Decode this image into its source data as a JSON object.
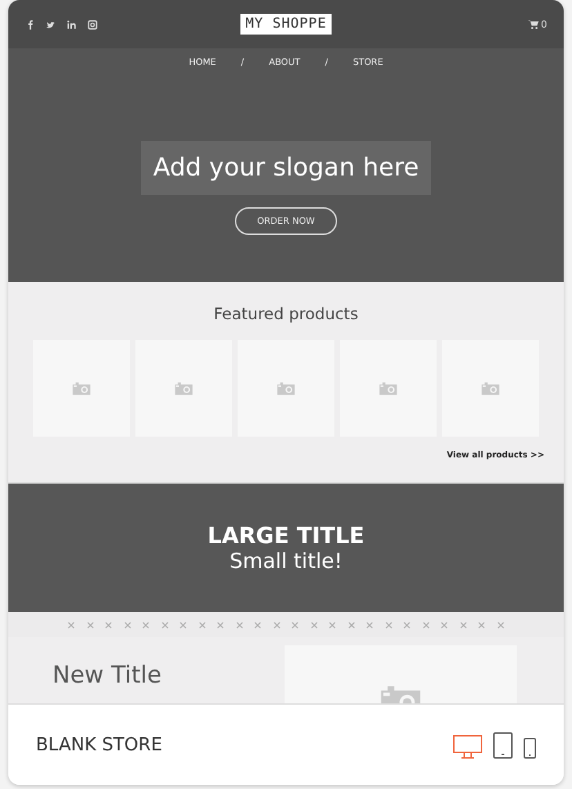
{
  "header": {
    "social": [
      {
        "kind": "facebook"
      },
      {
        "kind": "twitter"
      },
      {
        "kind": "linkedin"
      },
      {
        "kind": "instagram"
      }
    ],
    "logo": "MY SHOPPE",
    "cart_count": "0"
  },
  "nav": {
    "items": [
      "HOME",
      "ABOUT",
      "STORE"
    ],
    "separator": "/"
  },
  "hero": {
    "slogan": "Add your slogan here",
    "button": "ORDER NOW"
  },
  "featured": {
    "title": "Featured products",
    "products": [
      {
        "kind": "placeholder"
      },
      {
        "kind": "placeholder"
      },
      {
        "kind": "placeholder"
      },
      {
        "kind": "placeholder"
      },
      {
        "kind": "placeholder"
      }
    ],
    "link": "View all products >>"
  },
  "banner": {
    "title": "LARGE TITLE",
    "subtitle": "Small title!"
  },
  "section": {
    "title": "New Title"
  },
  "footer": {
    "name": "BLANK STORE",
    "devices": [
      {
        "kind": "desktop",
        "selected": true
      },
      {
        "kind": "tablet",
        "selected": false
      },
      {
        "kind": "phone",
        "selected": false
      }
    ]
  }
}
